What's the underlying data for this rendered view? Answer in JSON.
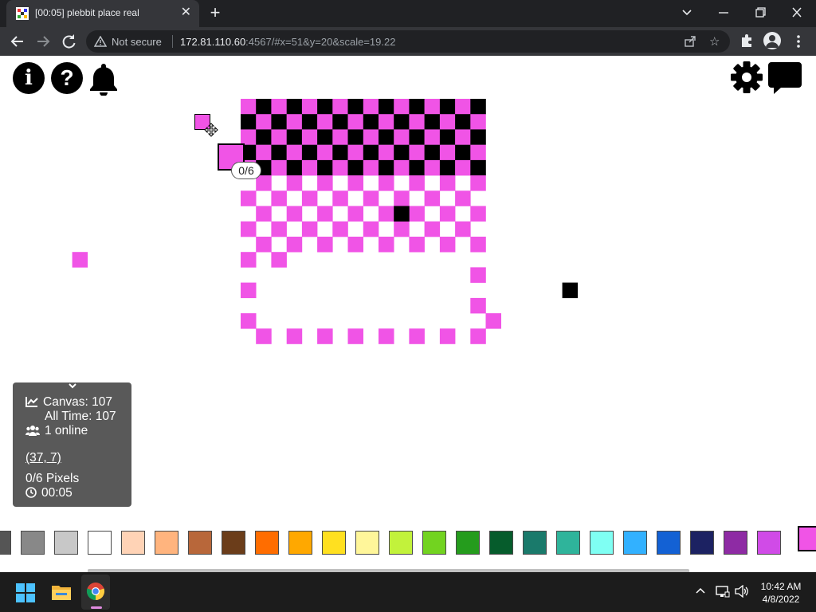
{
  "browser": {
    "tab_title": "[00:05] plebbit place real",
    "new_tab": "+",
    "security_label": "Not secure",
    "url_host": "172.81.110.60",
    "url_rest": ":4567/#x=51&y=20&scale=19.22"
  },
  "toolbar": {
    "icons": [
      "info-icon",
      "help-icon",
      "bell-icon",
      "gear-icon",
      "chat-icon"
    ],
    "info_label": "i",
    "help_label": "?"
  },
  "canvas": {
    "pixel_counter": "0/6",
    "colors": {
      "pink": "#f054e6",
      "black": "#000000"
    }
  },
  "info_panel": {
    "canvas_count": "Canvas: 107",
    "all_time": "All Time: 107",
    "online": "1 online",
    "coords": "(37, 7)",
    "pixels": "0/6 Pixels",
    "timer": "00:05"
  },
  "palette": {
    "colors": [
      "#555555",
      "#888888",
      "#c8c8c8",
      "#ffffff",
      "#ffd3b6",
      "#ffb47e",
      "#b8673a",
      "#6b3d1a",
      "#ff6d00",
      "#ffa800",
      "#ffe020",
      "#fff69a",
      "#c2f23b",
      "#72d320",
      "#259c1d",
      "#065c2c",
      "#1a7a6b",
      "#2fb49b",
      "#7ffff3",
      "#32b1ff",
      "#1361d4",
      "#1c2262",
      "#8e2ba4",
      "#d04be7",
      "#f054e6"
    ],
    "selected_index": 24
  },
  "taskbar": {
    "time": "10:42 AM",
    "date": "4/8/2022"
  }
}
